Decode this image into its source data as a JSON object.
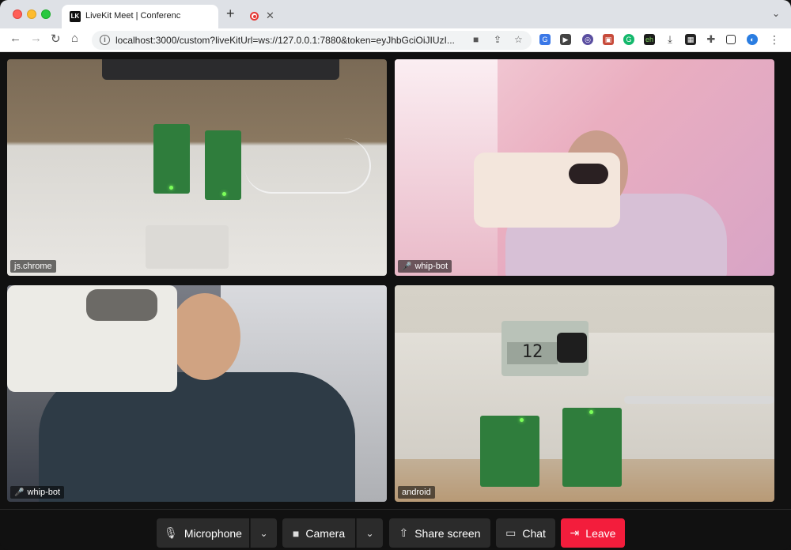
{
  "browser": {
    "tab_title": "LiveKit Meet | Conference",
    "tab_favicon_text": "LK",
    "tab_close": "✕",
    "new_tab": "+",
    "url": "localhost:3000/custom?liveKitUrl=ws://127.0.0.1:7880&token=eyJhbGciOiJIUzI...",
    "nav": {
      "back": "←",
      "forward": "→",
      "reload": "↻",
      "home": "⌂"
    }
  },
  "participants": [
    {
      "name": "js.chrome",
      "muted": false
    },
    {
      "name": "whip-bot",
      "muted": true
    },
    {
      "name": "whip-bot",
      "muted": true
    },
    {
      "name": "android",
      "muted": false
    }
  ],
  "controls": {
    "microphone": "Microphone",
    "camera": "Camera",
    "share_screen": "Share screen",
    "chat": "Chat",
    "leave": "Leave"
  },
  "colors": {
    "leave": "#f31d3c",
    "control_bg": "#2b2b2b",
    "stage_bg": "#111111"
  }
}
